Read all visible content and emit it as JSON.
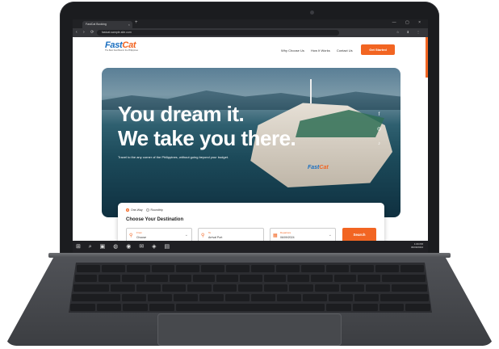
{
  "browser": {
    "tab_title": "FastCat Booking",
    "tab_close": "×",
    "new_tab": "+",
    "window_controls": "— ▢ ×",
    "nav_buttons": "‹ › ⟳",
    "url": "fastcat.sample-site.com",
    "extensions": "☆ ⬇ ⋮"
  },
  "site": {
    "logo_fast": "Fast",
    "logo_cat": "Cat",
    "logo_sub": "The Best Fast Boat in the Philippines",
    "nav": [
      "Why Choose Us",
      "How It Works",
      "Contact Us"
    ],
    "cta_label": "Get Started",
    "headline_line1": "You dream it.",
    "headline_line2": "We take you there.",
    "subline": "Travel to the any corner of the Philippines, without going beyond your budget.",
    "ship_logo_fast": "Fast",
    "ship_logo_cat": "Cat",
    "social_icons": [
      "f",
      "◎",
      "♪"
    ]
  },
  "booking": {
    "one_way": "One-Way",
    "roundtrip": "Roundtrip",
    "title": "Choose Your Destination",
    "from_label": "From",
    "from_value": "Choose",
    "to_label": "To",
    "to_value": "Arrival Port",
    "departure_label": "Departure",
    "departure_value": "06/09/2024",
    "search_label": "Search"
  },
  "taskbar": {
    "icons": "⊞ ⌕ ▣ ◍ ◉ ✉ ◈ ▤",
    "time": "1:09 PM",
    "date": "06/09/2024"
  },
  "colors": {
    "accent": "#f26522",
    "brand_blue": "#1a6fc0"
  }
}
